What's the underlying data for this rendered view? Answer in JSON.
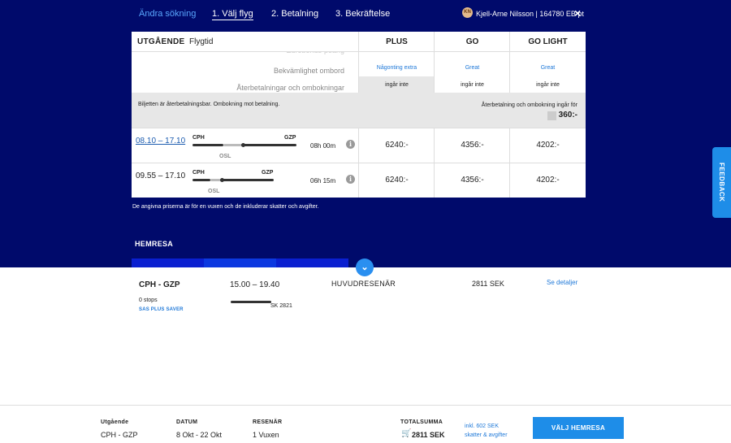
{
  "nav": {
    "change_search": "Ändra sökning",
    "steps": [
      "1. Välj flyg",
      "2. Betalning",
      "3. Bekräftelse"
    ],
    "user_initials": "KN",
    "user": "Kjell-Arne Nilsson | 164780 EB pt",
    "close": "×"
  },
  "table": {
    "header": {
      "outbound": "UTGÅENDE",
      "duration": "Flygtid",
      "columns": [
        "PLUS",
        "GO",
        "GO LIGHT"
      ]
    },
    "faded_row": "Eurobonus-poäng",
    "comparison": [
      {
        "label": "Bekvämlighet ombord",
        "values": [
          "Någonting extra",
          "Great",
          "Great"
        ]
      },
      {
        "label": "Återbetalningar och ombokningar",
        "values": [
          "ingår inte",
          "ingår inte",
          "ingår inte"
        ]
      }
    ],
    "info": {
      "left": "Biljetten är återbetalningsbar. Ombokning mot betalning.",
      "right": "Återbetalning och ombokning ingår för",
      "price": "360:-"
    },
    "flights": [
      {
        "time": "08.10 – 17.10",
        "from": "CPH",
        "to": "GZP",
        "via": "OSL",
        "duration": "08h 00m",
        "prices": [
          "6240:-",
          "4356:-",
          "4202:-"
        ]
      },
      {
        "time": "09.55 – 17.10",
        "from": "CPH",
        "to": "GZP",
        "via": "OSL",
        "duration": "06h 15m",
        "prices": [
          "6240:-",
          "4356:-",
          "4202:-"
        ]
      }
    ]
  },
  "disclaimer": "De angivna priserna är för en vuxen och de inkluderar skatter och avgifter.",
  "return": {
    "heading": "HEMRESA",
    "route": "CPH - GZP",
    "time": "15.00 – 19.40",
    "passenger": "HUVUDRESENÄR",
    "amount": "2811 SEK",
    "details": "Se detaljer",
    "stops": "0 stops",
    "fare": "SAS PLUS SAVER",
    "flight_no": "SK 2821"
  },
  "feedback": "FEEDBACK",
  "footer": {
    "outbound_label": "Utgående",
    "outbound_value": "CPH - GZP",
    "date_label": "DATUM",
    "date_value": "8 Okt - 22 Okt",
    "pax_label": "RESENÄR",
    "pax_value": "1 Vuxen",
    "total_label": "TOTALSUMMA",
    "total_value": "2811 SEK",
    "incl": "inkl. 602 SEK",
    "incl2": "skatter & avgifter",
    "button": "VÄLJ HEMRESA"
  },
  "colors": {
    "brand": "#000a6b",
    "accent": "#1e8de8"
  }
}
